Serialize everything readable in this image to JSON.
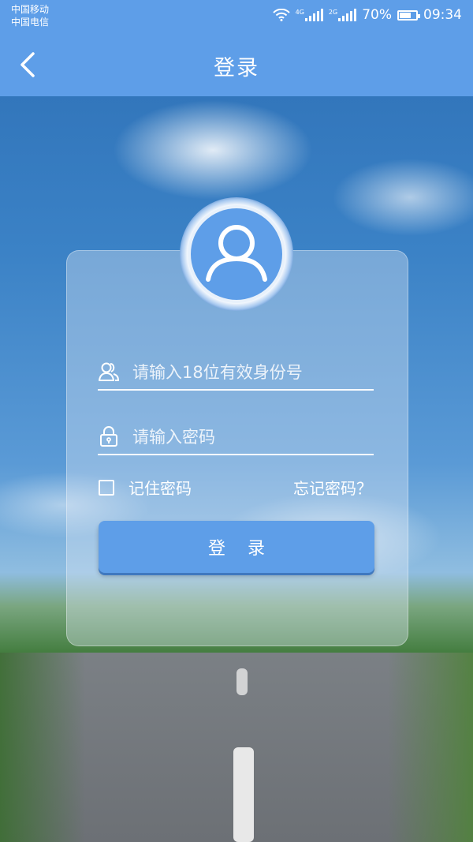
{
  "status_bar": {
    "carrier_1": "中国移动",
    "carrier_2": "中国电信",
    "network_1": "4G",
    "network_2": "2G",
    "battery_percent": "70%",
    "battery_level": 0.7,
    "time": "09:34"
  },
  "header": {
    "title": "登录",
    "back_icon": "chevron-left-icon"
  },
  "login_form": {
    "avatar_icon": "user-icon",
    "id_field": {
      "icon": "users-icon",
      "placeholder": "请输入18位有效身份号",
      "value": ""
    },
    "password_field": {
      "icon": "lock-icon",
      "placeholder": "请输入密码",
      "value": ""
    },
    "remember_label": "记住密码",
    "remember_checked": false,
    "forgot_label": "忘记密码？",
    "login_button_label": "登录"
  },
  "colors": {
    "primary": "#5e9ee8",
    "text": "#ffffff"
  }
}
